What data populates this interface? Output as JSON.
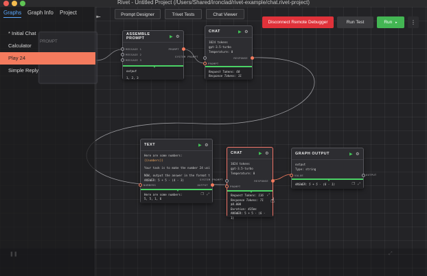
{
  "window": {
    "title": "Rivet - Untitled Project (/Users/Shared/ironclad/rivet-example/chat.rivet-project)"
  },
  "sidebar": {
    "tabs": [
      {
        "label": "Graphs"
      },
      {
        "label": "Graph Info"
      },
      {
        "label": "Project"
      }
    ],
    "graphs": [
      {
        "label": "* Initial Chat"
      },
      {
        "label": "Calculator"
      },
      {
        "label": "Play 24"
      },
      {
        "label": "Simple Reply"
      }
    ]
  },
  "toolbar": {
    "prompt_designer": "Prompt Designer",
    "trivet_tests": "Trivet Tests",
    "chat_viewer": "Chat Viewer",
    "disconnect": "Disconnect Remote Debugger",
    "run_test": "Run Test",
    "run": "Run",
    "menu": "⋮"
  },
  "icons": {
    "play": "play-icon",
    "gear": "gear-icon",
    "close": "close-icon"
  },
  "ghost": {
    "label": "PROMPT"
  },
  "nodes": {
    "assemble": {
      "title": "ASSEMBLE PROMPT",
      "ports_in": [
        "MESSAGE 1",
        "MESSAGE 2",
        "MESSAGE 3"
      ],
      "port_out": "PROMPT",
      "output_label": "output",
      "output_lines": [
        "...",
        "1, 2, 3"
      ]
    },
    "chat_top": {
      "title": "CHAT",
      "body": [
        "1024 tokens",
        "gpt-3.5-turbo",
        "Temperature: 0"
      ],
      "port_in_system": "SYSTEM PROMPT",
      "port_in_prompt": "PROMPT",
      "port_out": "RESPONSE",
      "output_lines": [
        "Request Tokens: 60",
        "Response Tokens: 11"
      ]
    },
    "text": {
      "title": "TEXT",
      "body": [
        "Here are some numbers:",
        "{{numbers}}",
        "",
        "Your task is to make the number 24 usi",
        "",
        "NOW, output the answer in the format t",
        "ANSWER: 5 + 5 - (4 - 3)"
      ],
      "port_in": "NUMBERS",
      "port_out": "OUTPUT",
      "output_lines": [
        "Here are some numbers:",
        "5, 5, 1, 6"
      ]
    },
    "chat_main": {
      "title": "CHAT",
      "body": [
        "1024 tokens",
        "gpt-3.5-turbo",
        "Temperature: 0"
      ],
      "port_in_system": "SYSTEM PROMPT",
      "port_in_prompt": "PROMPT",
      "port_out": "RESPONSE",
      "output_lines": [
        "Request Tokens: 116",
        "Response Tokens: 71",
        "$0.000",
        "Duration: 415ms",
        "ANSWER: 5 + 5 - (6 - 1)"
      ]
    },
    "graph_output": {
      "title": "GRAPH OUTPUT",
      "body": [
        "output",
        "Type: string"
      ],
      "port_in": "VALUE",
      "port_out": "OUTPUT",
      "output_lines": [
        "ANSWER: 5 + 5 - (6 - 1)"
      ]
    }
  },
  "colors": {
    "accent": "#f47b5e",
    "run": "#43b653",
    "danger": "#e0323a",
    "link": "#5aa8ff",
    "exec": "#4bd366"
  }
}
